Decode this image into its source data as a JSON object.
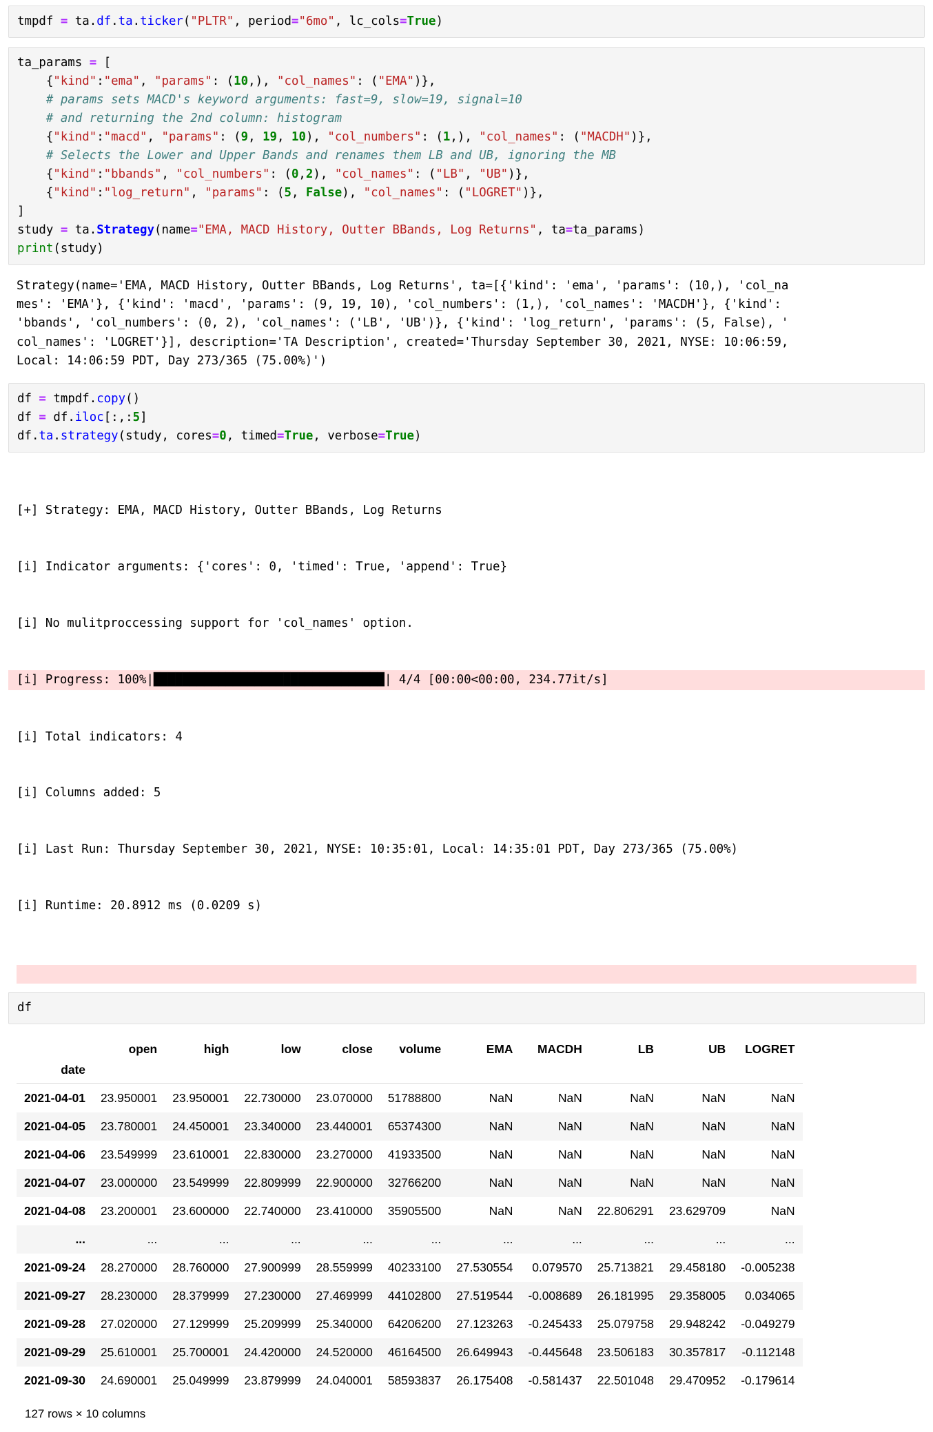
{
  "cells": [
    {
      "name": "cell-ticker",
      "type": "code",
      "lines": [
        [
          {
            "t": "tmpdf ",
            "c": "plain"
          },
          {
            "t": "=",
            "c": "op"
          },
          {
            "t": " ta.",
            "c": "plain"
          },
          {
            "t": "df",
            "c": "attr"
          },
          {
            "t": ".",
            "c": "plain"
          },
          {
            "t": "ta",
            "c": "attr"
          },
          {
            "t": ".",
            "c": "plain"
          },
          {
            "t": "ticker",
            "c": "attr"
          },
          {
            "t": "(",
            "c": "plain"
          },
          {
            "t": "\"PLTR\"",
            "c": "str"
          },
          {
            "t": ", period",
            "c": "plain"
          },
          {
            "t": "=",
            "c": "op"
          },
          {
            "t": "\"6mo\"",
            "c": "str"
          },
          {
            "t": ", lc_cols",
            "c": "plain"
          },
          {
            "t": "=",
            "c": "op"
          },
          {
            "t": "True",
            "c": "kw"
          },
          {
            "t": ")",
            "c": "plain"
          }
        ]
      ]
    },
    {
      "name": "cell-strategy",
      "type": "code",
      "lines": [
        [
          {
            "t": "ta_params ",
            "c": "plain"
          },
          {
            "t": "=",
            "c": "op"
          },
          {
            "t": " [",
            "c": "plain"
          }
        ],
        [
          {
            "t": "    {",
            "c": "plain"
          },
          {
            "t": "\"kind\"",
            "c": "str"
          },
          {
            "t": ":",
            "c": "plain"
          },
          {
            "t": "\"ema\"",
            "c": "str"
          },
          {
            "t": ", ",
            "c": "plain"
          },
          {
            "t": "\"params\"",
            "c": "str"
          },
          {
            "t": ": (",
            "c": "plain"
          },
          {
            "t": "10",
            "c": "num"
          },
          {
            "t": ",), ",
            "c": "plain"
          },
          {
            "t": "\"col_names\"",
            "c": "str"
          },
          {
            "t": ": (",
            "c": "plain"
          },
          {
            "t": "\"EMA\"",
            "c": "str"
          },
          {
            "t": ")},",
            "c": "plain"
          }
        ],
        [
          {
            "t": "    # params sets MACD's keyword arguments: fast=9, slow=19, signal=10",
            "c": "com"
          }
        ],
        [
          {
            "t": "    # and returning the 2nd column: histogram",
            "c": "com"
          }
        ],
        [
          {
            "t": "    {",
            "c": "plain"
          },
          {
            "t": "\"kind\"",
            "c": "str"
          },
          {
            "t": ":",
            "c": "plain"
          },
          {
            "t": "\"macd\"",
            "c": "str"
          },
          {
            "t": ", ",
            "c": "plain"
          },
          {
            "t": "\"params\"",
            "c": "str"
          },
          {
            "t": ": (",
            "c": "plain"
          },
          {
            "t": "9",
            "c": "num"
          },
          {
            "t": ", ",
            "c": "plain"
          },
          {
            "t": "19",
            "c": "num"
          },
          {
            "t": ", ",
            "c": "plain"
          },
          {
            "t": "10",
            "c": "num"
          },
          {
            "t": "), ",
            "c": "plain"
          },
          {
            "t": "\"col_numbers\"",
            "c": "str"
          },
          {
            "t": ": (",
            "c": "plain"
          },
          {
            "t": "1",
            "c": "num"
          },
          {
            "t": ",), ",
            "c": "plain"
          },
          {
            "t": "\"col_names\"",
            "c": "str"
          },
          {
            "t": ": (",
            "c": "plain"
          },
          {
            "t": "\"MACDH\"",
            "c": "str"
          },
          {
            "t": ")},",
            "c": "plain"
          }
        ],
        [
          {
            "t": "    # Selects the Lower and Upper Bands and renames them LB and UB, ignoring the MB",
            "c": "com"
          }
        ],
        [
          {
            "t": "    {",
            "c": "plain"
          },
          {
            "t": "\"kind\"",
            "c": "str"
          },
          {
            "t": ":",
            "c": "plain"
          },
          {
            "t": "\"bbands\"",
            "c": "str"
          },
          {
            "t": ", ",
            "c": "plain"
          },
          {
            "t": "\"col_numbers\"",
            "c": "str"
          },
          {
            "t": ": (",
            "c": "plain"
          },
          {
            "t": "0",
            "c": "num"
          },
          {
            "t": ",",
            "c": "plain"
          },
          {
            "t": "2",
            "c": "num"
          },
          {
            "t": "), ",
            "c": "plain"
          },
          {
            "t": "\"col_names\"",
            "c": "str"
          },
          {
            "t": ": (",
            "c": "plain"
          },
          {
            "t": "\"LB\"",
            "c": "str"
          },
          {
            "t": ", ",
            "c": "plain"
          },
          {
            "t": "\"UB\"",
            "c": "str"
          },
          {
            "t": ")},",
            "c": "plain"
          }
        ],
        [
          {
            "t": "    {",
            "c": "plain"
          },
          {
            "t": "\"kind\"",
            "c": "str"
          },
          {
            "t": ":",
            "c": "plain"
          },
          {
            "t": "\"log_return\"",
            "c": "str"
          },
          {
            "t": ", ",
            "c": "plain"
          },
          {
            "t": "\"params\"",
            "c": "str"
          },
          {
            "t": ": (",
            "c": "plain"
          },
          {
            "t": "5",
            "c": "num"
          },
          {
            "t": ", ",
            "c": "plain"
          },
          {
            "t": "False",
            "c": "kw"
          },
          {
            "t": "), ",
            "c": "plain"
          },
          {
            "t": "\"col_names\"",
            "c": "str"
          },
          {
            "t": ": (",
            "c": "plain"
          },
          {
            "t": "\"LOGRET\"",
            "c": "str"
          },
          {
            "t": ")},",
            "c": "plain"
          }
        ],
        [
          {
            "t": "]",
            "c": "plain"
          }
        ],
        [
          {
            "t": "study ",
            "c": "plain"
          },
          {
            "t": "=",
            "c": "op"
          },
          {
            "t": " ta.",
            "c": "plain"
          },
          {
            "t": "Strategy",
            "c": "cls"
          },
          {
            "t": "(name",
            "c": "plain"
          },
          {
            "t": "=",
            "c": "op"
          },
          {
            "t": "\"EMA, MACD History, Outter BBands, Log Returns\"",
            "c": "str"
          },
          {
            "t": ", ta",
            "c": "plain"
          },
          {
            "t": "=",
            "c": "op"
          },
          {
            "t": "ta_params)",
            "c": "plain"
          }
        ],
        [
          {
            "t": "print",
            "c": "bltn"
          },
          {
            "t": "(study)",
            "c": "plain"
          }
        ]
      ]
    }
  ],
  "strategy_output": {
    "name": "strategy-repr-output",
    "lines": [
      "Strategy(name='EMA, MACD History, Outter BBands, Log Returns', ta=[{'kind': 'ema', 'params': (10,), 'col_na",
      "mes': 'EMA'}, {'kind': 'macd', 'params': (9, 19, 10), 'col_numbers': (1,), 'col_names': 'MACDH'}, {'kind':",
      "'bbands', 'col_numbers': (0, 2), 'col_names': ('LB', 'UB')}, {'kind': 'log_return', 'params': (5, False), '",
      "col_names': 'LOGRET'}], description='TA Description', created='Thursday September 30, 2021, NYSE: 10:06:59,",
      "Local: 14:06:59 PDT, Day 273/365 (75.00%)')"
    ]
  },
  "run_cell": {
    "name": "cell-run-strategy",
    "lines": [
      [
        {
          "t": "df ",
          "c": "plain"
        },
        {
          "t": "=",
          "c": "op"
        },
        {
          "t": " tmpdf.",
          "c": "plain"
        },
        {
          "t": "copy",
          "c": "attr"
        },
        {
          "t": "()",
          "c": "plain"
        }
      ],
      [
        {
          "t": "df ",
          "c": "plain"
        },
        {
          "t": "=",
          "c": "op"
        },
        {
          "t": " df.",
          "c": "plain"
        },
        {
          "t": "iloc",
          "c": "attr"
        },
        {
          "t": "[:,:",
          "c": "plain"
        },
        {
          "t": "5",
          "c": "num"
        },
        {
          "t": "]",
          "c": "plain"
        }
      ],
      [
        {
          "t": "df.",
          "c": "plain"
        },
        {
          "t": "ta",
          "c": "attr"
        },
        {
          "t": ".",
          "c": "plain"
        },
        {
          "t": "strategy",
          "c": "attr"
        },
        {
          "t": "(study, cores",
          "c": "plain"
        },
        {
          "t": "=",
          "c": "op"
        },
        {
          "t": "0",
          "c": "num"
        },
        {
          "t": ", timed",
          "c": "plain"
        },
        {
          "t": "=",
          "c": "op"
        },
        {
          "t": "True",
          "c": "kw"
        },
        {
          "t": ", verbose",
          "c": "plain"
        },
        {
          "t": "=",
          "c": "op"
        },
        {
          "t": "True",
          "c": "kw"
        },
        {
          "t": ")",
          "c": "plain"
        }
      ]
    ]
  },
  "verbose_output": {
    "name": "strategy-verbose-output",
    "line_strategy": "[+] Strategy: EMA, MACD History, Outter BBands, Log Returns",
    "line_args": "[i] Indicator arguments: {'cores': 0, 'timed': True, 'append': True}",
    "line_nomp": "[i] No mulitproccessing support for 'col_names' option.",
    "progress_prefix": "[i] Progress: 100%|",
    "progress_bar": "████████████████████████████████",
    "progress_suffix": "| 4/4 [00:00<00:00, 234.77it/s]",
    "line_total": "[i] Total indicators: 4",
    "line_cols": "[i] Columns added: 5",
    "line_lastrun": "[i] Last Run: Thursday September 30, 2021, NYSE: 10:35:01, Local: 14:35:01 PDT, Day 273/365 (75.00%)",
    "line_runtime": "[i] Runtime: 20.8912 ms (0.0209 s)"
  },
  "df_cell": {
    "name": "cell-show-df",
    "lines": [
      [
        {
          "t": "df",
          "c": "plain"
        }
      ]
    ]
  },
  "dataframe": {
    "index_name": "date",
    "columns": [
      "open",
      "high",
      "low",
      "close",
      "volume",
      "EMA",
      "MACDH",
      "LB",
      "UB",
      "LOGRET"
    ],
    "rows": [
      {
        "index": "2021-04-01",
        "values": [
          "23.950001",
          "23.950001",
          "22.730000",
          "23.070000",
          "51788800",
          "NaN",
          "NaN",
          "NaN",
          "NaN",
          "NaN"
        ]
      },
      {
        "index": "2021-04-05",
        "values": [
          "23.780001",
          "24.450001",
          "23.340000",
          "23.440001",
          "65374300",
          "NaN",
          "NaN",
          "NaN",
          "NaN",
          "NaN"
        ]
      },
      {
        "index": "2021-04-06",
        "values": [
          "23.549999",
          "23.610001",
          "22.830000",
          "23.270000",
          "41933500",
          "NaN",
          "NaN",
          "NaN",
          "NaN",
          "NaN"
        ]
      },
      {
        "index": "2021-04-07",
        "values": [
          "23.000000",
          "23.549999",
          "22.809999",
          "22.900000",
          "32766200",
          "NaN",
          "NaN",
          "NaN",
          "NaN",
          "NaN"
        ]
      },
      {
        "index": "2021-04-08",
        "values": [
          "23.200001",
          "23.600000",
          "22.740000",
          "23.410000",
          "35905500",
          "NaN",
          "NaN",
          "22.806291",
          "23.629709",
          "NaN"
        ]
      },
      {
        "index": "...",
        "values": [
          "...",
          "...",
          "...",
          "...",
          "...",
          "...",
          "...",
          "...",
          "...",
          "..."
        ]
      },
      {
        "index": "2021-09-24",
        "values": [
          "28.270000",
          "28.760000",
          "27.900999",
          "28.559999",
          "40233100",
          "27.530554",
          "0.079570",
          "25.713821",
          "29.458180",
          "-0.005238"
        ]
      },
      {
        "index": "2021-09-27",
        "values": [
          "28.230000",
          "28.379999",
          "27.230000",
          "27.469999",
          "44102800",
          "27.519544",
          "-0.008689",
          "26.181995",
          "29.358005",
          "0.034065"
        ]
      },
      {
        "index": "2021-09-28",
        "values": [
          "27.020000",
          "27.129999",
          "25.209999",
          "25.340000",
          "64206200",
          "27.123263",
          "-0.245433",
          "25.079758",
          "29.948242",
          "-0.049279"
        ]
      },
      {
        "index": "2021-09-29",
        "values": [
          "25.610001",
          "25.700001",
          "24.420000",
          "24.520000",
          "46164500",
          "26.649943",
          "-0.445648",
          "23.506183",
          "30.357817",
          "-0.112148"
        ]
      },
      {
        "index": "2021-09-30",
        "values": [
          "24.690001",
          "25.049999",
          "23.879999",
          "24.040001",
          "58593837",
          "26.175408",
          "-0.581437",
          "22.501048",
          "29.470952",
          "-0.179614"
        ]
      }
    ],
    "shape_label": "127 rows × 10 columns"
  },
  "colors": {
    "code_bg": "#f5f5f5",
    "code_border": "#e0e0e0",
    "stderr_bg": "#ffdddd",
    "string": "#ba2121",
    "number": "#008000",
    "comment": "#408080",
    "operator": "#aa22ff",
    "attribute": "#0000ff",
    "row_stripe": "#f5f5f5"
  }
}
